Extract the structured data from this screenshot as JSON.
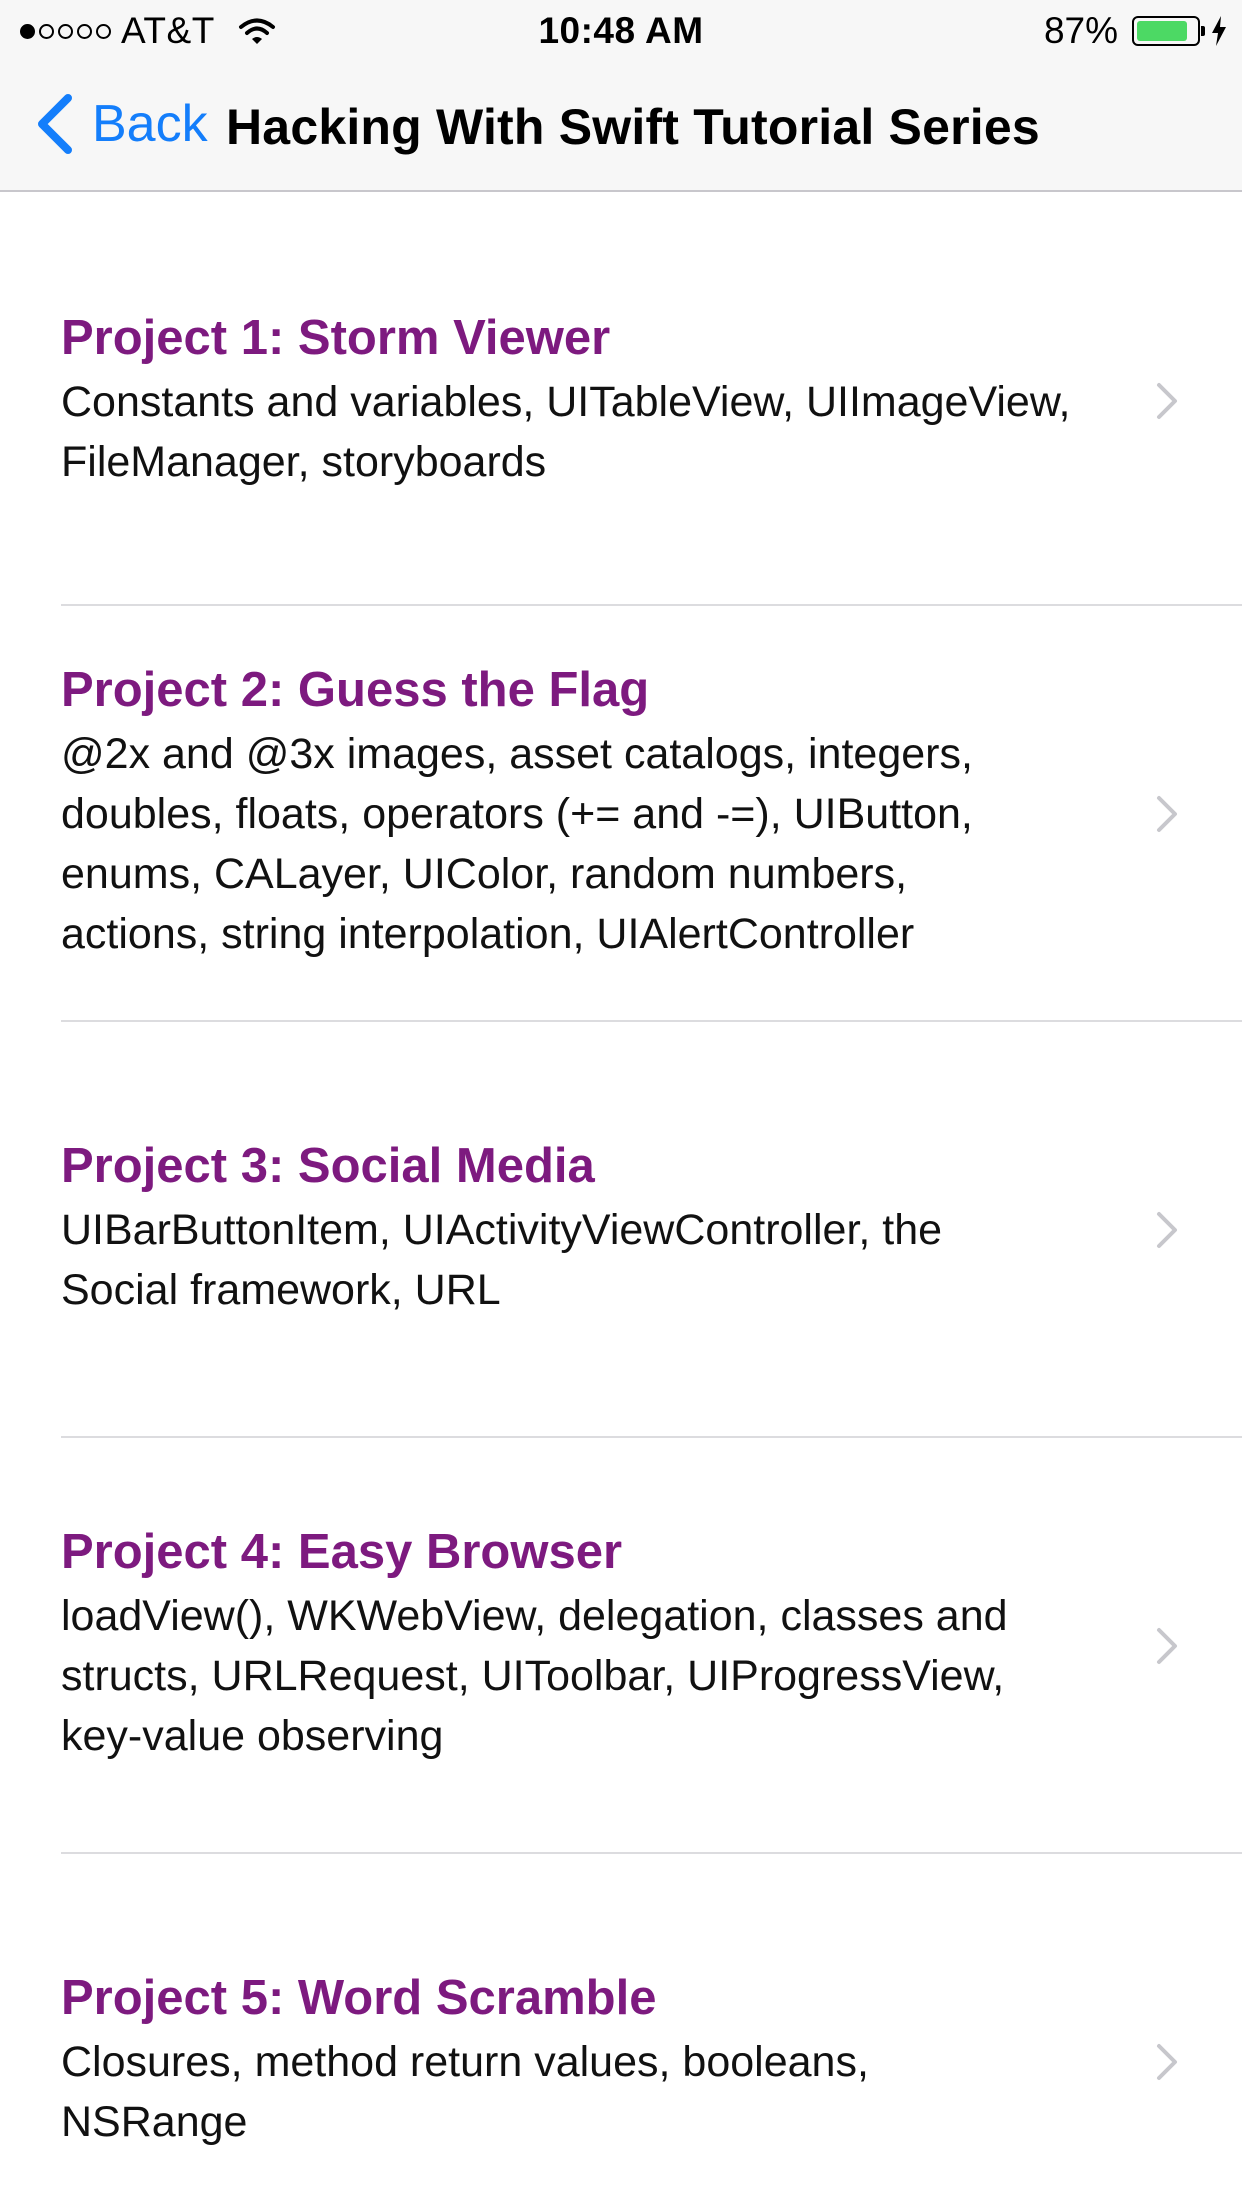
{
  "status_bar": {
    "carrier": "AT&T",
    "signal_bars_filled": 1,
    "signal_bars_total": 5,
    "time": "10:48 AM",
    "battery_percent": "87%",
    "battery_level": 0.87,
    "battery_color": "#4cd964",
    "icons": [
      "wifi-icon",
      "battery-icon",
      "charging-bolt-icon"
    ]
  },
  "nav": {
    "back_label": "Back",
    "title": "Hacking With Swift Tutorial Series",
    "accent_color": "#147efb"
  },
  "projects": [
    {
      "title": "Project 1: Storm Viewer",
      "subtitle": "Constants and variables, UITableView, UIImageView,\nFileManager, storyboards"
    },
    {
      "title": "Project 2: Guess the Flag",
      "subtitle": "@2x and @3x images, asset catalogs, integers,\ndoubles, floats, operators (+= and -=), UIButton,\nenums, CALayer, UIColor, random numbers,\nactions, string interpolation, UIAlertController"
    },
    {
      "title": "Project 3: Social Media",
      "subtitle": "UIBarButtonItem, UIActivityViewController, the\nSocial framework, URL"
    },
    {
      "title": "Project 4: Easy Browser",
      "subtitle": "loadView(), WKWebView, delegation, classes and\nstructs, URLRequest, UIToolbar, UIProgressView,\nkey-value observing"
    },
    {
      "title": "Project 5: Word Scramble",
      "subtitle": "Closures, method return values, booleans,\nNSRange"
    }
  ],
  "title_color": "#7d1a7f"
}
